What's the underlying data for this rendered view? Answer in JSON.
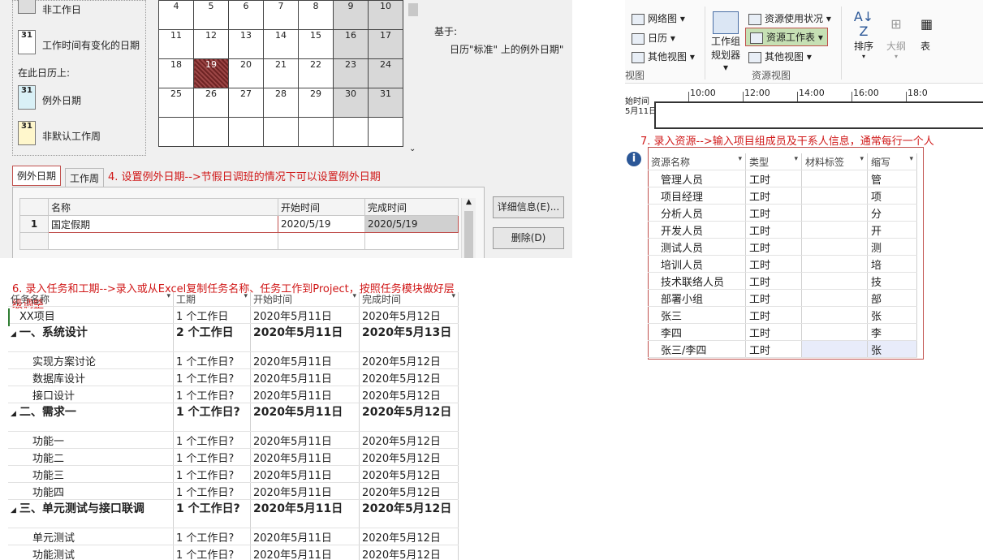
{
  "calendar_dialog": {
    "legend": {
      "partial_top_label": "非工作日",
      "changed_hours_icon": "31",
      "changed_hours_label": "工作时间有变化的日期",
      "on_this_calendar": "在此日历上:",
      "exception_icon": "31",
      "exception_label": "例外日期",
      "nondefault_icon": "31",
      "nondefault_label": "非默认工作周"
    },
    "calendar_rows": [
      [
        "4",
        "5",
        "6",
        "7",
        "8",
        "9",
        "10"
      ],
      [
        "11",
        "12",
        "13",
        "14",
        "15",
        "16",
        "17"
      ],
      [
        "18",
        "19",
        "20",
        "21",
        "22",
        "23",
        "24"
      ],
      [
        "25",
        "26",
        "27",
        "28",
        "29",
        "30",
        "31"
      ],
      [
        "",
        "",
        "",
        "",
        "",
        "",
        ""
      ]
    ],
    "based_on_label": "基于:",
    "based_on_value": "日历\"标准\" 上的例外日期\"",
    "tabs": [
      "例外日期",
      "工作周"
    ],
    "annotation": "4. 设置例外日期-->节假日调班的情况下可以设置例外日期",
    "exception_table": {
      "headers": [
        "名称",
        "开始时间",
        "完成时间"
      ],
      "rows": [
        {
          "id": "1",
          "name": "国定假期",
          "start": "2020/5/19",
          "finish": "2020/5/19"
        }
      ]
    },
    "details_button": "详细信息(E)...",
    "delete_button": "删除(D)"
  },
  "resource_panel": {
    "ribbon": {
      "network_diagram": "网络图",
      "calendar": "日历",
      "other_views_1": "其他视图",
      "team_planner_line1": "工作组",
      "team_planner_line2": "规划器",
      "resource_usage": "资源使用状况",
      "resource_sheet": "资源工作表",
      "other_views_2": "其他视图",
      "sort": "排序",
      "outline": "大纲",
      "table_partial": "表",
      "group_left": "视图",
      "group_resource_views": "资源视图"
    },
    "timeline": {
      "label_line1": "始时间",
      "label_line2": "5月11日",
      "times": [
        "10:00",
        "12:00",
        "14:00",
        "16:00",
        "18:0"
      ]
    },
    "annotation": "7. 录入资源-->输入项目组成员及干系人信息，通常每行一个人",
    "table": {
      "headers": [
        "资源名称",
        "类型",
        "材料标签",
        "缩写"
      ],
      "rows": [
        {
          "name": "管理人员",
          "type": "工时",
          "material": "",
          "initial": "管"
        },
        {
          "name": "项目经理",
          "type": "工时",
          "material": "",
          "initial": "项"
        },
        {
          "name": "分析人员",
          "type": "工时",
          "material": "",
          "initial": "分"
        },
        {
          "name": "开发人员",
          "type": "工时",
          "material": "",
          "initial": "开"
        },
        {
          "name": "测试人员",
          "type": "工时",
          "material": "",
          "initial": "测"
        },
        {
          "name": "培训人员",
          "type": "工时",
          "material": "",
          "initial": "培"
        },
        {
          "name": "技术联络人员",
          "type": "工时",
          "material": "",
          "initial": "技"
        },
        {
          "name": "部署小组",
          "type": "工时",
          "material": "",
          "initial": "部"
        },
        {
          "name": "张三",
          "type": "工时",
          "material": "",
          "initial": "张"
        },
        {
          "name": "李四",
          "type": "工时",
          "material": "",
          "initial": "李"
        },
        {
          "name": "张三/李四",
          "type": "工时",
          "material": "",
          "initial": "张"
        }
      ]
    }
  },
  "task_panel": {
    "annotation": "6. 录入任务和工期-->录入或从Excel复制任务名称、任务工作到Project，按照任务模块做好层级调整",
    "headers": [
      "任务名称",
      "工期",
      "开始时间",
      "完成时间"
    ],
    "rows": [
      {
        "name": "XX项目",
        "duration": "1 个工作日",
        "start": "2020年5月11日",
        "finish": "2020年5月12日",
        "summary": false,
        "indent": 1
      },
      {
        "name": "一、系统设计",
        "duration": "2 个工作日",
        "start": "2020年5月11日",
        "finish": "2020年5月13日",
        "summary": true,
        "indent": 0
      },
      {
        "name": "实现方案讨论",
        "duration": "1 个工作日?",
        "start": "2020年5月11日",
        "finish": "2020年5月12日",
        "summary": false,
        "indent": 2
      },
      {
        "name": "数据库设计",
        "duration": "1 个工作日?",
        "start": "2020年5月11日",
        "finish": "2020年5月12日",
        "summary": false,
        "indent": 2
      },
      {
        "name": "接口设计",
        "duration": "1 个工作日?",
        "start": "2020年5月11日",
        "finish": "2020年5月12日",
        "summary": false,
        "indent": 2
      },
      {
        "name": "二、需求一",
        "duration": "1 个工作日?",
        "start": "2020年5月11日",
        "finish": "2020年5月12日",
        "summary": true,
        "indent": 0
      },
      {
        "name": "功能一",
        "duration": "1 个工作日?",
        "start": "2020年5月11日",
        "finish": "2020年5月12日",
        "summary": false,
        "indent": 2
      },
      {
        "name": "功能二",
        "duration": "1 个工作日?",
        "start": "2020年5月11日",
        "finish": "2020年5月12日",
        "summary": false,
        "indent": 2
      },
      {
        "name": "功能三",
        "duration": "1 个工作日?",
        "start": "2020年5月11日",
        "finish": "2020年5月12日",
        "summary": false,
        "indent": 2
      },
      {
        "name": "功能四",
        "duration": "1 个工作日?",
        "start": "2020年5月11日",
        "finish": "2020年5月12日",
        "summary": false,
        "indent": 2
      },
      {
        "name": "三、单元测试与接口联调",
        "duration": "1 个工作日?",
        "start": "2020年5月11日",
        "finish": "2020年5月12日",
        "summary": true,
        "indent": 0
      },
      {
        "name": "单元测试",
        "duration": "1 个工作日?",
        "start": "2020年5月11日",
        "finish": "2020年5月12日",
        "summary": false,
        "indent": 2
      },
      {
        "name": "功能测试",
        "duration": "1 个工作日?",
        "start": "2020年5月11日",
        "finish": "2020年5月12日",
        "summary": false,
        "indent": 2
      }
    ]
  },
  "colors": {
    "annotation_red": "#d01818",
    "weekend_gray": "#d8d8d8",
    "exception_day": "#8b3a3a",
    "highlight_green": "#c6e0b4"
  }
}
